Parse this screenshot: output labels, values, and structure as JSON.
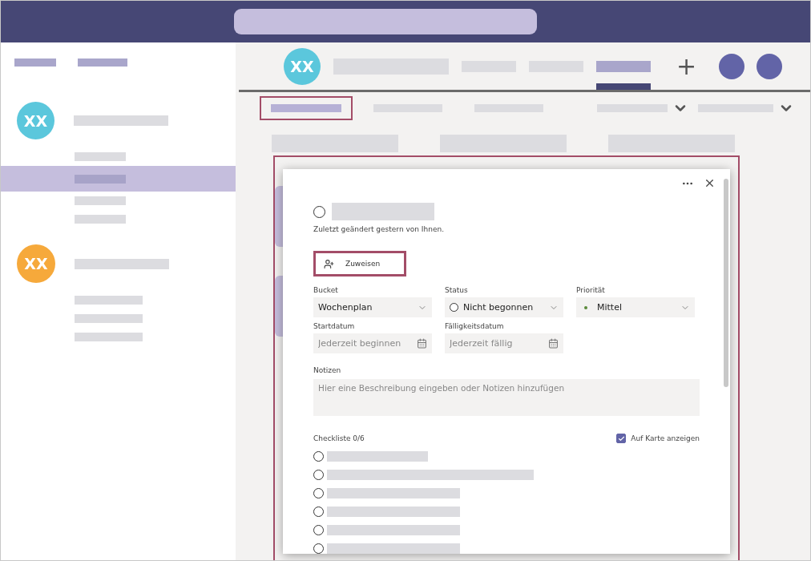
{
  "sidebar": {
    "teams": [
      {
        "avatar": "XX",
        "color": "#5bc7dc",
        "channels": [
          {
            "selected": false
          },
          {
            "selected": true
          },
          {
            "selected": false
          },
          {
            "selected": false
          }
        ]
      },
      {
        "avatar": "XX",
        "color": "#f6a93b",
        "channels": [
          {
            "selected": false
          },
          {
            "selected": false
          },
          {
            "selected": false
          }
        ]
      }
    ]
  },
  "header": {
    "avatar": "XX",
    "tabs": [
      {
        "selected": false
      },
      {
        "selected": false
      },
      {
        "selected": false
      },
      {
        "selected": true
      }
    ],
    "add": "+"
  },
  "subtabs": [
    {
      "selected": true
    },
    {
      "selected": false
    },
    {
      "selected": false
    }
  ],
  "task": {
    "completed": false,
    "subtitle": "Zuletzt geändert gestern von Ihnen.",
    "assign_button": "Zuweisen",
    "fields": [
      {
        "kind": "select",
        "label": "Bucket",
        "value": "Wochenplan"
      },
      {
        "kind": "status",
        "label": "Status",
        "value": "Nicht begonnen"
      },
      {
        "kind": "priority",
        "label": "Priorität",
        "value": "Mittel"
      },
      {
        "kind": "date",
        "label": "Startdatum",
        "placeholder": "Jederzeit beginnen"
      },
      {
        "kind": "date",
        "label": "Fälligkeitsdatum",
        "placeholder": "Jederzeit fällig"
      }
    ],
    "notes": {
      "label": "Notizen",
      "placeholder": "Hier eine Beschreibung eingeben oder Notizen hinzufügen"
    },
    "checklist": {
      "title": "Checkliste 0/6",
      "show_on_card": {
        "label": "Auf Karte anzeigen",
        "checked": true
      },
      "items": [
        {
          "checked": false
        },
        {
          "checked": false
        },
        {
          "checked": false
        },
        {
          "checked": false
        },
        {
          "checked": false
        },
        {
          "checked": false
        }
      ]
    }
  }
}
